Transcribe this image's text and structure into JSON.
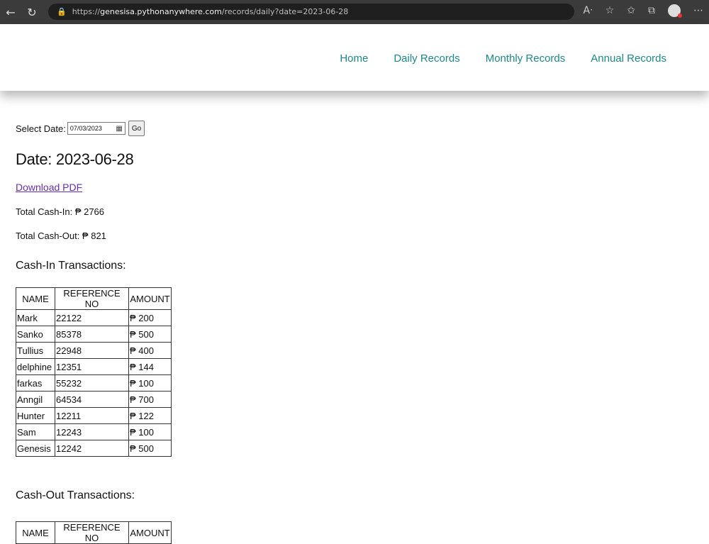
{
  "browser": {
    "url_prefix": "https://",
    "url_host": "genesisa.pythonanywhere.com",
    "url_path": "/records/daily?date=2023-06-28",
    "icons": [
      "back-icon",
      "refresh-icon",
      "lock-icon",
      "read-aloud-icon",
      "favorites-add-icon",
      "favorites-icon",
      "collections-icon",
      "profile-avatar",
      "more-icon"
    ]
  },
  "nav": {
    "home": "Home",
    "daily": "Daily Records",
    "monthly": "Monthly Records",
    "annual": "Annual Records"
  },
  "date_selector": {
    "label": "Select Date:",
    "value": "07/03/2023",
    "go_label": "Go"
  },
  "heading": "Date: 2023-06-28",
  "download_pdf": "Download PDF",
  "totals": {
    "cash_in": "Total Cash-In: ₱ 2766",
    "cash_out": "Total Cash-Out: ₱ 821"
  },
  "cash_in": {
    "title": "Cash-In Transactions:",
    "headers": [
      "NAME",
      "REFERENCE NO",
      "AMOUNT"
    ],
    "rows": [
      [
        "Mark",
        "22122",
        "₱ 200"
      ],
      [
        "Sanko",
        "85378",
        "₱ 500"
      ],
      [
        "Tullius",
        "22948",
        "₱ 400"
      ],
      [
        "delphine",
        "12351",
        "₱ 144"
      ],
      [
        "farkas",
        "55232",
        "₱ 100"
      ],
      [
        "Anngil",
        "64534",
        "₱ 700"
      ],
      [
        "Hunter",
        "12211",
        "₱ 122"
      ],
      [
        "Sam",
        "12243",
        "₱ 100"
      ],
      [
        "Genesis",
        "12242",
        "₱ 500"
      ]
    ]
  },
  "cash_out": {
    "title": "Cash-Out Transactions:",
    "headers": [
      "NAME",
      "REFERENCE NO",
      "AMOUNT"
    ]
  }
}
